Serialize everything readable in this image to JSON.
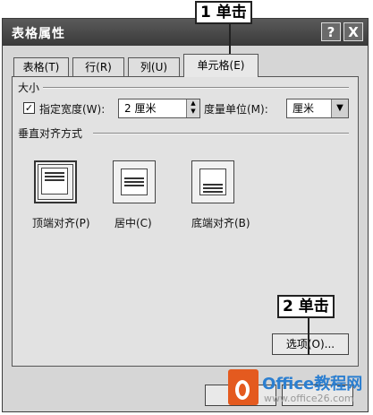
{
  "dialog": {
    "title": "表格属性",
    "help_button": "?",
    "close_button": "X"
  },
  "tabs": [
    {
      "label": "表格(T)"
    },
    {
      "label": "行(R)"
    },
    {
      "label": "列(U)"
    },
    {
      "label": "单元格(E)",
      "active": true
    }
  ],
  "size_section": {
    "heading": "大小",
    "checkbox_checked": true,
    "width_label": "指定宽度(W):",
    "width_value": "2 厘米",
    "unit_label": "度量单位(M):",
    "unit_value": "厘米"
  },
  "valign_section": {
    "heading": "垂直对齐方式",
    "options": [
      {
        "label": "顶端对齐(P)",
        "selected": true
      },
      {
        "label": "居中(C)",
        "selected": false
      },
      {
        "label": "底端对齐(B)",
        "selected": false
      }
    ]
  },
  "options_button": "选项(O)...",
  "annotations": {
    "step1": "1 单击",
    "step2": "2 单击"
  },
  "watermark": {
    "brand": "Office教程网",
    "url": "www.office26.com"
  }
}
